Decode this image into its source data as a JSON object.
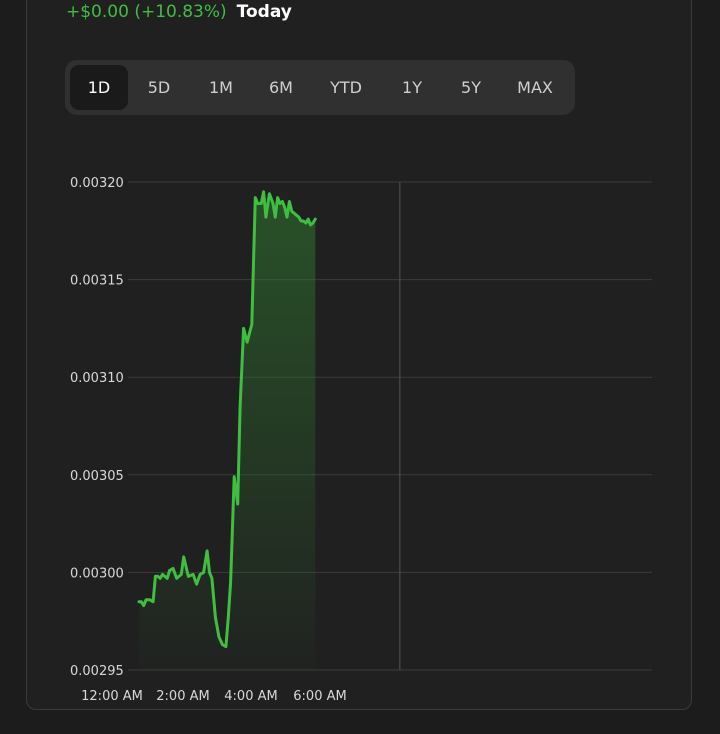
{
  "header": {
    "change_text": "+$0.00 (+10.83%)",
    "period_label": "Today"
  },
  "ranges": {
    "active": "1D",
    "items": [
      "1D",
      "5D",
      "1M",
      "6M",
      "YTD",
      "1Y",
      "5Y",
      "MAX"
    ]
  },
  "colors": {
    "line": "#3fbf3f",
    "fill": "#2e6b2e",
    "background": "#202020",
    "grid": "#3b3b3b"
  },
  "chart_data": {
    "type": "area",
    "title": "",
    "xlabel": "",
    "ylabel": "",
    "ylim": [
      0.00295,
      0.0032
    ],
    "yticks": [
      "0.00320",
      "0.00315",
      "0.00310",
      "0.00305",
      "0.00300",
      "0.00295"
    ],
    "xticks": [
      "12:00 AM",
      "2:00 AM",
      "4:00 AM",
      "6:00 AM"
    ],
    "x_hours_range": [
      0,
      16
    ],
    "current_marker_hour": 11.1,
    "grid": true,
    "series": [
      {
        "x": [
          0.0,
          0.1,
          0.2,
          0.3,
          0.45,
          0.6,
          0.7,
          0.8,
          0.9,
          1.0,
          1.2,
          1.3,
          1.45,
          1.6,
          1.8,
          1.9,
          2.1,
          2.3,
          2.45,
          2.6,
          2.75,
          2.9,
          3.0,
          3.1,
          3.25,
          3.4,
          3.55,
          3.7,
          3.8,
          3.9,
          4.05,
          4.2,
          4.3,
          4.45,
          4.6,
          4.8,
          4.95,
          5.05,
          5.2,
          5.3,
          5.4,
          5.55,
          5.7,
          5.8,
          5.9,
          6.0,
          6.1,
          6.2,
          6.3,
          6.4,
          6.5,
          6.6,
          6.7,
          6.8,
          6.9,
          7.0,
          7.1,
          7.2,
          7.3,
          7.4,
          7.5
        ],
        "values": [
          0.002985,
          0.002985,
          0.002983,
          0.002986,
          0.002986,
          0.002985,
          0.002998,
          0.002998,
          0.002997,
          0.002999,
          0.002997,
          0.003001,
          0.003002,
          0.002997,
          0.002999,
          0.003008,
          0.002998,
          0.002999,
          0.002994,
          0.002999,
          0.003,
          0.003011,
          0.003,
          0.002997,
          0.002977,
          0.002967,
          0.002963,
          0.002962,
          0.002977,
          0.002995,
          0.003049,
          0.003035,
          0.003085,
          0.003125,
          0.003118,
          0.003127,
          0.003192,
          0.003189,
          0.003189,
          0.003195,
          0.003182,
          0.003194,
          0.003189,
          0.003182,
          0.003192,
          0.003189,
          0.00319,
          0.003187,
          0.003182,
          0.00319,
          0.003185,
          0.003184,
          0.003183,
          0.003182,
          0.00318,
          0.00318,
          0.003179,
          0.003181,
          0.003178,
          0.003179,
          0.003181
        ]
      }
    ]
  }
}
